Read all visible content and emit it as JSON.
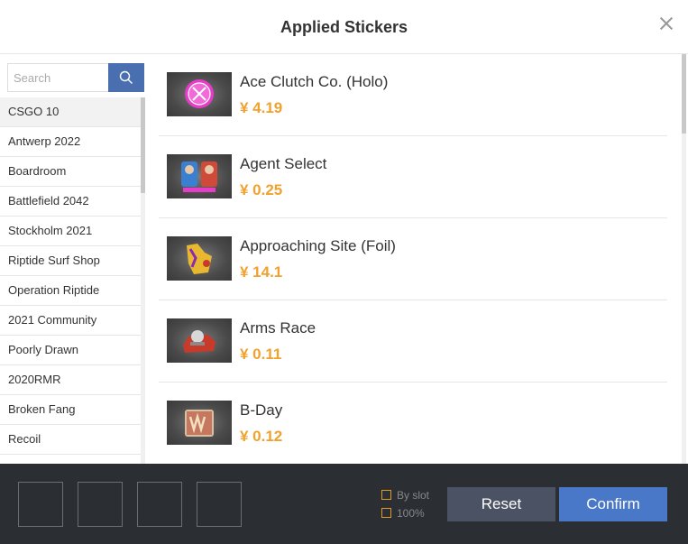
{
  "header": {
    "title": "Applied Stickers"
  },
  "search": {
    "placeholder": "Search"
  },
  "categories": [
    "CSGO 10",
    "Antwerp 2022",
    "Boardroom",
    "Battlefield 2042",
    "Stockholm 2021",
    "Riptide Surf Shop",
    "Operation Riptide",
    "2021 Community",
    "Poorly Drawn",
    "2020RMR",
    "Broken Fang",
    "Recoil"
  ],
  "stickers": [
    {
      "name": "Ace Clutch Co. (Holo)",
      "price": "¥ 4.19"
    },
    {
      "name": "Agent Select",
      "price": "¥ 0.25"
    },
    {
      "name": "Approaching Site (Foil)",
      "price": "¥ 14.1"
    },
    {
      "name": "Arms Race",
      "price": "¥ 0.11"
    },
    {
      "name": "B-Day",
      "price": "¥ 0.12"
    }
  ],
  "footer": {
    "options": {
      "by_slot": "By slot",
      "percent": "100%"
    },
    "reset_label": "Reset",
    "confirm_label": "Confirm"
  },
  "colors": {
    "accent": "#f0a12e",
    "primary": "#4a78c8",
    "footer_bg": "#2b2e33"
  }
}
